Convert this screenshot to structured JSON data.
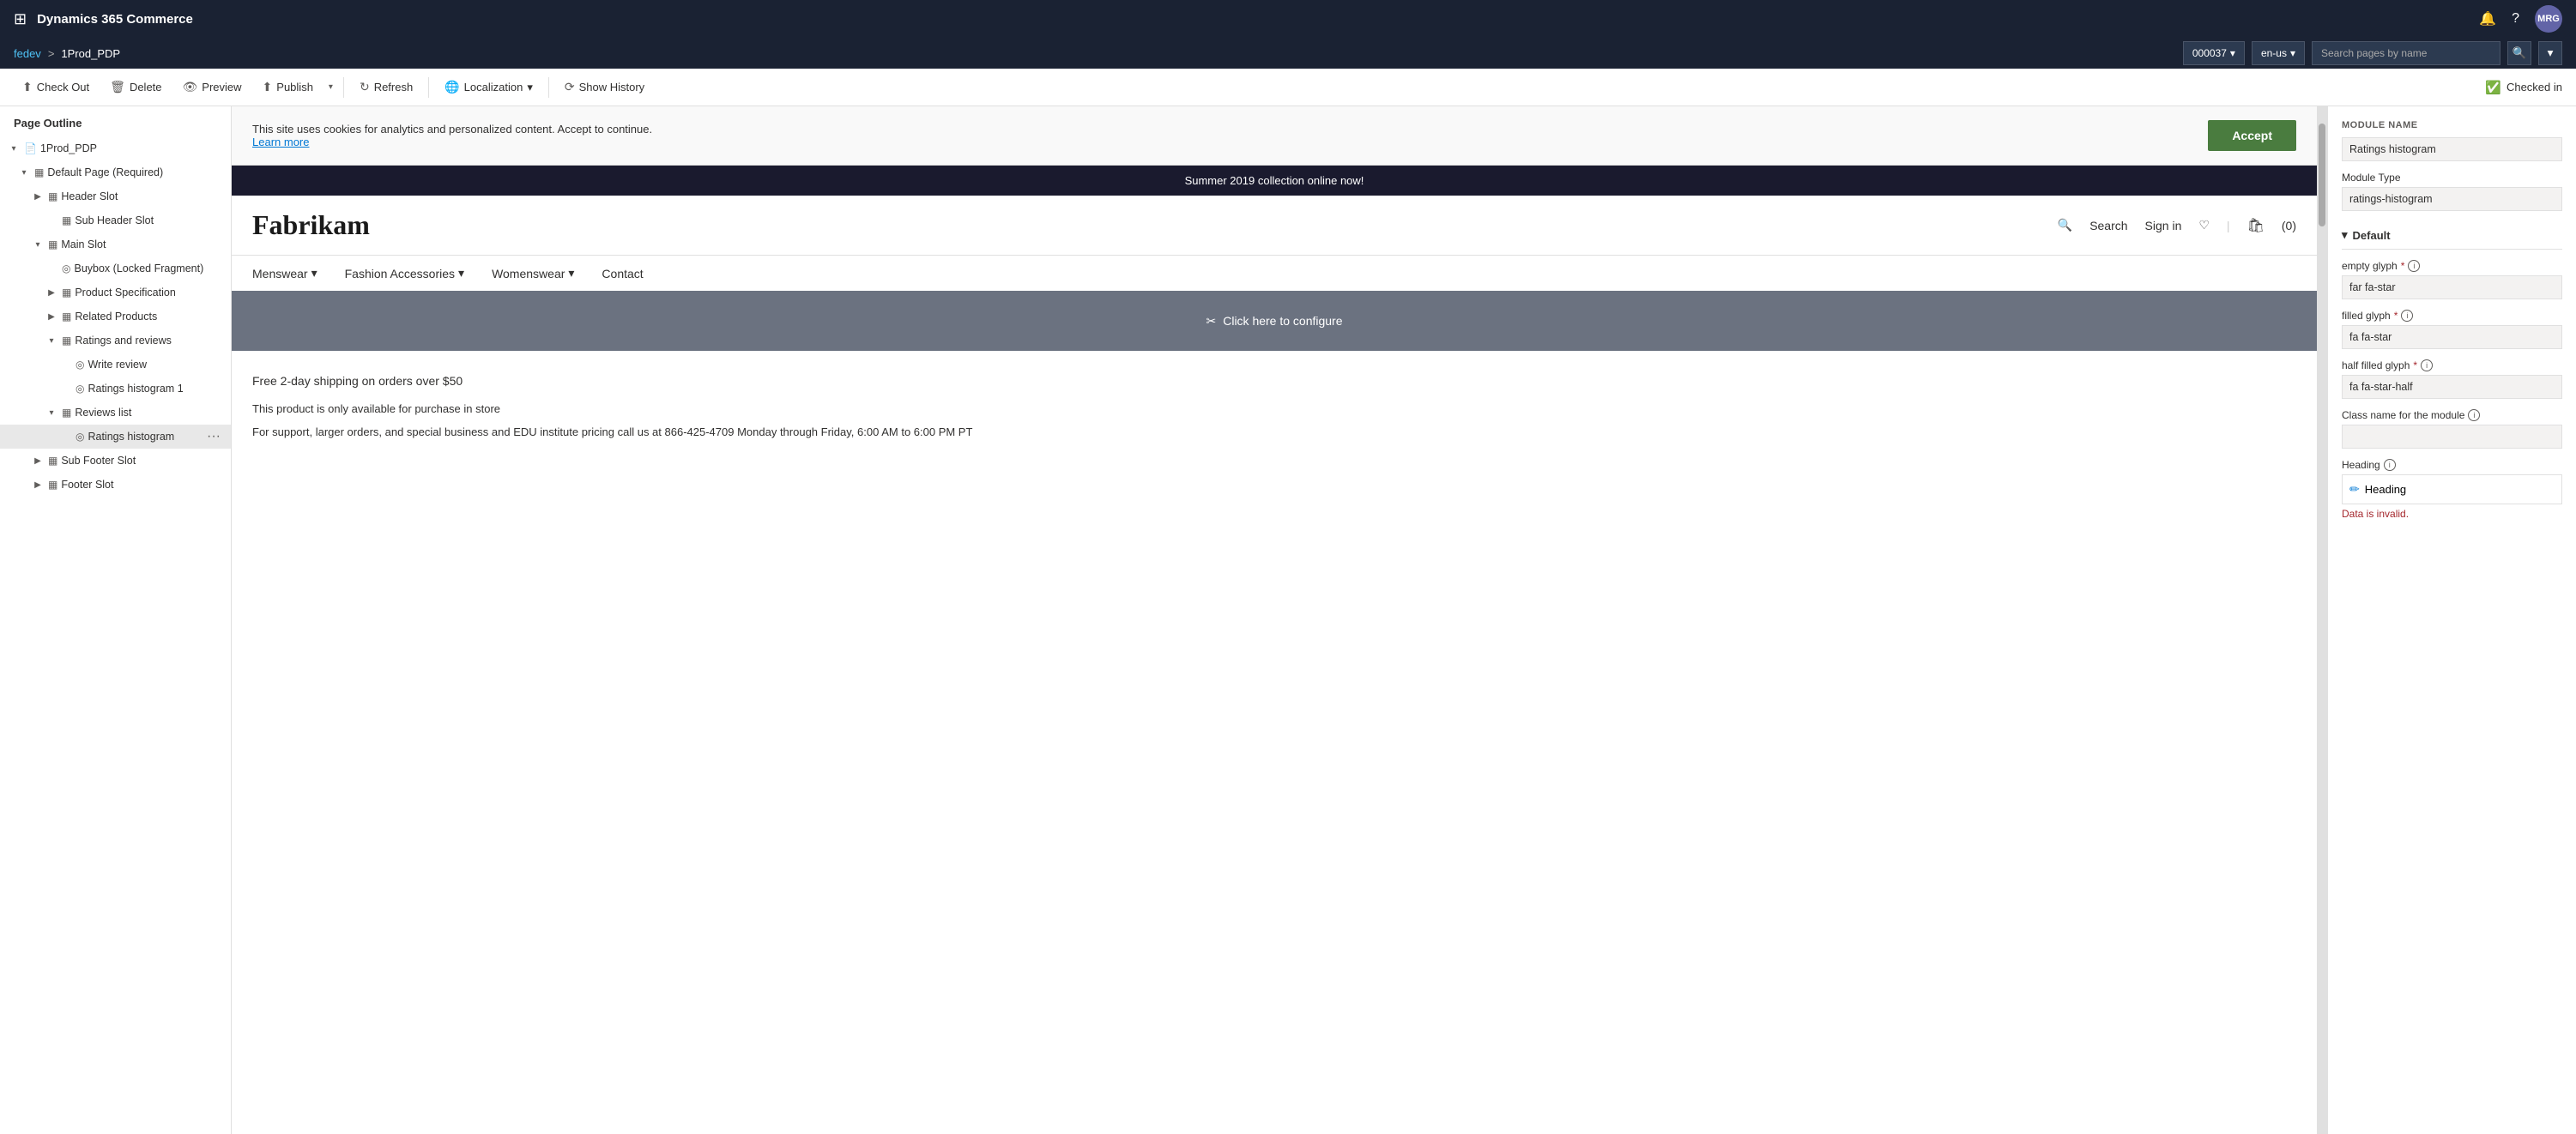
{
  "topBar": {
    "gridIcon": "⊞",
    "title": "Dynamics 365 Commerce",
    "bellIcon": "🔔",
    "helpIcon": "?",
    "avatarLabel": "MRG"
  },
  "breadcrumb": {
    "link": "fedev",
    "separator": ">",
    "current": "1Prod_PDP",
    "storeId": "000037",
    "locale": "en-us",
    "searchPlaceholder": "Search pages by name"
  },
  "toolbar": {
    "checkOut": "Check Out",
    "delete": "Delete",
    "preview": "Preview",
    "publish": "Publish",
    "refresh": "Refresh",
    "localization": "Localization",
    "showHistory": "Show History",
    "checkedIn": "Checked in"
  },
  "sidebar": {
    "title": "Page Outline",
    "tree": [
      {
        "id": "root",
        "indent": 0,
        "expand": "▾",
        "icon": "📄",
        "label": "1Prod_PDP",
        "iconType": "page"
      },
      {
        "id": "default-page",
        "indent": 1,
        "expand": "▾",
        "icon": "▦",
        "label": "Default Page (Required)",
        "iconType": "container"
      },
      {
        "id": "header-slot",
        "indent": 2,
        "expand": "▶",
        "icon": "▦",
        "label": "Header Slot",
        "iconType": "container"
      },
      {
        "id": "sub-header-slot",
        "indent": 3,
        "expand": "",
        "icon": "▦",
        "label": "Sub Header Slot",
        "iconType": "container"
      },
      {
        "id": "main-slot",
        "indent": 2,
        "expand": "▾",
        "icon": "▦",
        "label": "Main Slot",
        "iconType": "container"
      },
      {
        "id": "buybox",
        "indent": 3,
        "expand": "",
        "icon": "◎",
        "label": "Buybox (Locked Fragment)",
        "iconType": "fragment"
      },
      {
        "id": "product-spec",
        "indent": 3,
        "expand": "▶",
        "icon": "▦",
        "label": "Product Specification",
        "iconType": "container"
      },
      {
        "id": "related-products",
        "indent": 3,
        "expand": "▶",
        "icon": "▦",
        "label": "Related Products",
        "iconType": "container"
      },
      {
        "id": "ratings-reviews",
        "indent": 3,
        "expand": "▾",
        "icon": "▦",
        "label": "Ratings and reviews",
        "iconType": "container"
      },
      {
        "id": "write-review",
        "indent": 4,
        "expand": "",
        "icon": "◎",
        "label": "Write review",
        "iconType": "module"
      },
      {
        "id": "ratings-histogram-1",
        "indent": 4,
        "expand": "",
        "icon": "◎",
        "label": "Ratings histogram 1",
        "iconType": "module"
      },
      {
        "id": "reviews-list",
        "indent": 3,
        "expand": "▾",
        "icon": "▦",
        "label": "Reviews list",
        "iconType": "container"
      },
      {
        "id": "ratings-histogram",
        "indent": 4,
        "expand": "",
        "icon": "◎",
        "label": "Ratings histogram",
        "iconType": "module",
        "selected": true,
        "hasMore": true
      }
    ],
    "afterTree": [
      {
        "id": "sub-footer-slot",
        "indent": 2,
        "expand": "▶",
        "icon": "▦",
        "label": "Sub Footer Slot",
        "iconType": "container"
      },
      {
        "id": "footer-slot",
        "indent": 2,
        "expand": "▶",
        "icon": "▦",
        "label": "Footer Slot",
        "iconType": "container"
      }
    ]
  },
  "preview": {
    "cookieBanner": {
      "text": "This site uses cookies for analytics and personalized content. Accept to continue.",
      "learnMore": "Learn more",
      "acceptBtn": "Accept"
    },
    "announcement": "Summer 2019 collection online now!",
    "storeLogo": "Fabrikam",
    "navRight": {
      "search": "Search",
      "signIn": "Sign in",
      "wishlistIcon": "♡",
      "cartLabel": "(0)"
    },
    "categoryNav": [
      {
        "label": "Menswear",
        "hasDropdown": true
      },
      {
        "label": "Fashion Accessories",
        "hasDropdown": true
      },
      {
        "label": "Womenswear",
        "hasDropdown": true
      },
      {
        "label": "Contact",
        "hasDropdown": false
      }
    ],
    "configureArea": {
      "icon": "✂",
      "text": "Click here to configure"
    },
    "productInfo": {
      "shipping": "Free 2-day shipping on orders over $50",
      "storeOnly": "This product is only available for purchase in store",
      "support": "For support, larger orders, and special business and EDU institute pricing call us at 866-425-4709 Monday through Friday, 6:00 AM to 6:00 PM PT"
    }
  },
  "rightPanel": {
    "moduleName": {
      "label": "MODULE NAME",
      "value": "Ratings histogram"
    },
    "moduleType": {
      "label": "Module Type",
      "value": "ratings-histogram"
    },
    "defaultSection": {
      "label": "Default",
      "collapseIcon": "▾"
    },
    "emptyGlyph": {
      "label": "empty glyph",
      "required": true,
      "value": "far fa-star"
    },
    "filledGlyph": {
      "label": "filled glyph",
      "required": true,
      "value": "fa fa-star"
    },
    "halfFilledGlyph": {
      "label": "half filled glyph",
      "required": true,
      "value": "fa fa-star-half"
    },
    "classNameLabel": "Class name for the module",
    "classNameValue": "",
    "heading": {
      "label": "Heading",
      "editLabel": "Heading",
      "editIcon": "✏",
      "invalidText": "Data is invalid."
    }
  }
}
